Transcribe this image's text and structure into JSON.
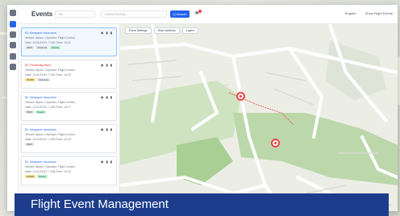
{
  "app": {
    "title": "Events",
    "select_value": "All",
    "search_placeholder": "Search Events",
    "search_button": "Q Search",
    "lang": "English",
    "show_all": "Show Flight Events"
  },
  "rail": [
    "home-icon",
    "list-icon",
    "layers-icon",
    "filter-icon",
    "book-icon",
    "settings-icon"
  ],
  "events": [
    {
      "title": "ID: Airspace Incursion",
      "line1": "Vehicle: Alpha   •   Operator: Flight Control",
      "line2": "Date: 11/11/23   ID: 7,042   Time: 14:21",
      "tags": [
        "INFO",
        "Outcome",
        "Ready"
      ],
      "color": "blue",
      "selected": true
    },
    {
      "title": "ID: Proximity Alert",
      "line1": "Vehicle: Alpha   •   Operator: Flight Control",
      "line2": "Date: 11/11/23   ID: 7,041   Time: 14:19",
      "tags": [
        "WARN",
        "Outcome"
      ],
      "color": "red",
      "selected": false
    },
    {
      "title": "ID: Airspace Incursion",
      "line1": "Vehicle: Alpha   •   Operator: Flight Control",
      "line2": "Date: 11/11/23   ID: 7,040   Time: 14:17",
      "tags": [
        "INFO",
        "Ready"
      ],
      "color": "blue",
      "selected": false
    },
    {
      "title": "ID: Airspace Incursion",
      "line1": "Vehicle: Alpha   •   Operator: Flight Control",
      "line2": "Date: 11/11/23   ID: 7,039   Time: 14:15",
      "tags": [
        "INFO"
      ],
      "color": "blue",
      "selected": false
    },
    {
      "title": "ID: Airspace Incursion",
      "line1": "Vehicle: Alpha   •   Operator: Flight Control",
      "line2": "Date: 11/11/23   ID: 7,038   Time: 14:12",
      "tags": [
        "WARN",
        "Ready"
      ],
      "color": "blue",
      "selected": false
    }
  ],
  "map": {
    "chips": [
      "Event Settings",
      "Hide Incidents",
      "Layers"
    ],
    "tools": "▣ ⊕ ⊖ ⤢ ⋯"
  },
  "caption": "Flight Event Management",
  "colors": {
    "accent": "#2563eb",
    "alert": "#ef4444",
    "banner": "#1d3d8c"
  }
}
